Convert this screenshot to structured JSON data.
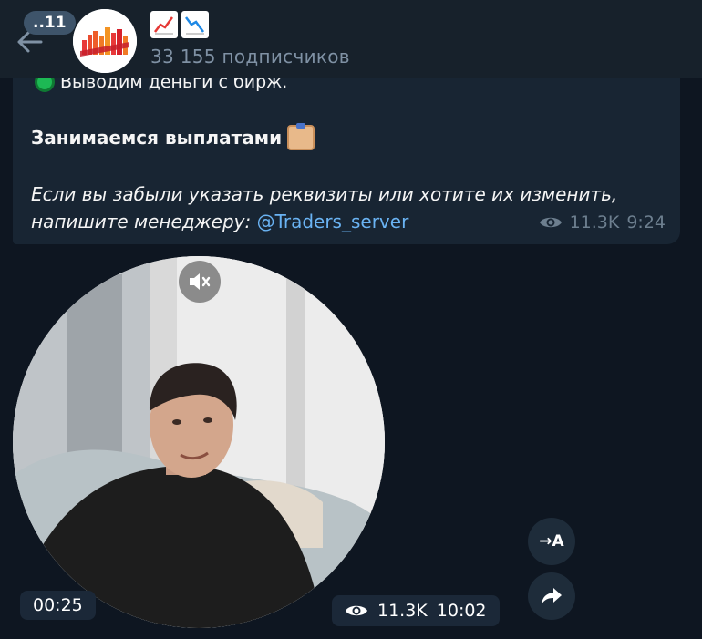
{
  "header": {
    "unread_count": "..11",
    "title_icons": [
      "chart-increasing-icon",
      "chart-decreasing-icon"
    ],
    "subscribers": "33 155 подписчиков"
  },
  "message": {
    "first_line": "Выводим деньги с бирж.",
    "heading": "Занимаемся выплатами",
    "body_text": "Если вы забыли указать реквизиты или хотите их изменить, напишите менеджеру: ",
    "link": "@Traders_server",
    "views": "11.3K",
    "time": "9:24"
  },
  "video_message": {
    "duration": "00:25",
    "views": "11.3K",
    "time": "10:02"
  },
  "side_buttons": {
    "translate_label": "→A"
  },
  "colors": {
    "background": "#0e1621",
    "header": "#17212b",
    "bubble": "#182533",
    "link": "#6ab3f3",
    "muted": "#7f91a4"
  }
}
